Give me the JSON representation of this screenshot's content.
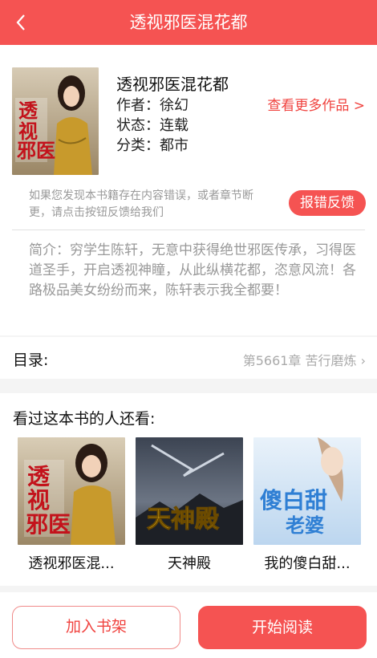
{
  "topbar": {
    "title": "透视邪医混花都",
    "back_icon": "back-icon"
  },
  "book": {
    "title": "透视邪医混花都",
    "author": "作者：徐幻",
    "status": "状态：连载",
    "category": "分类：都市",
    "more_works": "查看更多作品 >",
    "notice": "如果您发现本书籍存在内容错误，或者章节断更，请点击按钮反馈给我们",
    "report_button": "报错反馈",
    "intro": "简介：穷学生陈轩，无意中获得绝世邪医传承，习得医道圣手，开启透视神瞳，从此纵横花都，恣意风流！各路极品美女纷纷而来，陈轩表示我全都要！"
  },
  "toc": {
    "label": "目录:",
    "latest_chapter": "第5661章 苦行磨炼 ›"
  },
  "recommend": {
    "title": "看过这本书的人还看:",
    "items": [
      {
        "name": "透视邪医混..."
      },
      {
        "name": "天神殿"
      },
      {
        "name": "我的傻白甜..."
      }
    ]
  },
  "bottom": {
    "shelf_button": "加入书架",
    "read_button": "开始阅读"
  },
  "colors": {
    "accent": "#f55352",
    "text_muted": "#999999"
  }
}
